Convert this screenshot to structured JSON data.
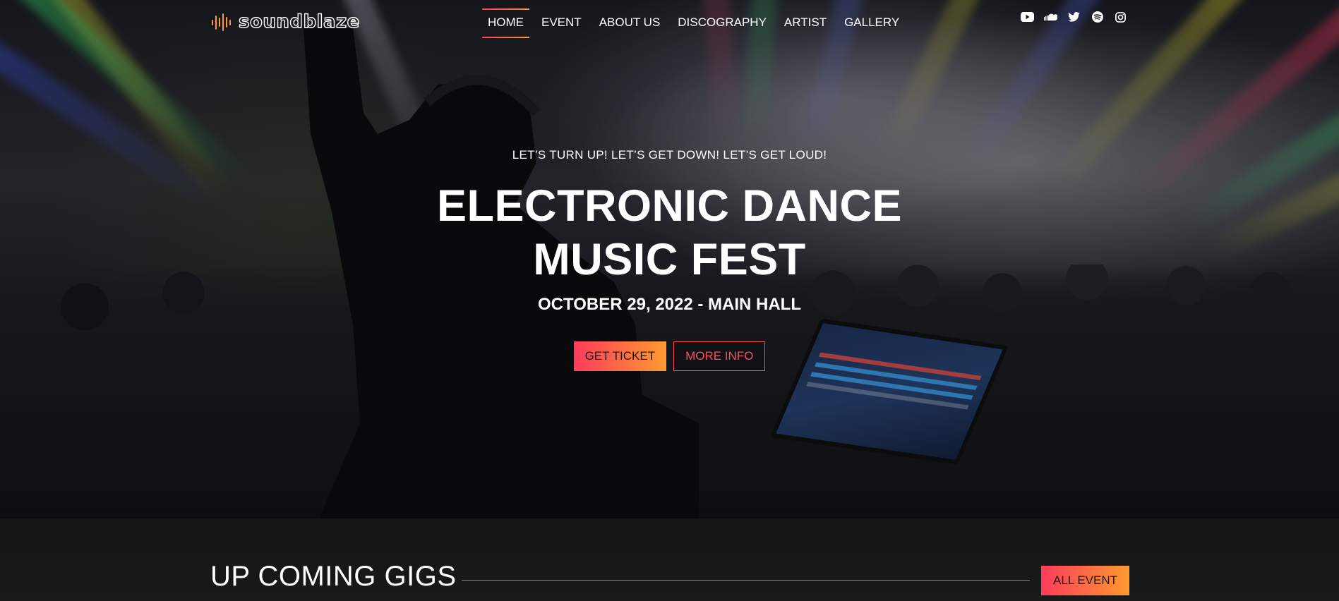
{
  "brand": {
    "name": "soundblaze"
  },
  "nav": {
    "items": [
      {
        "label": "HOME",
        "active": true
      },
      {
        "label": "EVENT",
        "active": false
      },
      {
        "label": "ABOUT US",
        "active": false
      },
      {
        "label": "DISCOGRAPHY",
        "active": false
      },
      {
        "label": "ARTIST",
        "active": false
      },
      {
        "label": "GALLERY",
        "active": false
      }
    ]
  },
  "social": [
    "youtube-icon",
    "soundcloud-icon",
    "twitter-icon",
    "spotify-icon",
    "instagram-icon"
  ],
  "hero": {
    "tagline": "LET’S TURN UP! LET’S GET DOWN! LET’S GET LOUD!",
    "title": "ELECTRONIC DANCE MUSIC FEST",
    "date": "OCTOBER 29, 2022 - MAIN HALL",
    "primary_button": "GET TICKET",
    "secondary_button": "MORE INFO"
  },
  "gigs": {
    "title": "UP COMING GIGS",
    "button": "ALL EVENT"
  },
  "colors": {
    "accent_start": "#ff3b5c",
    "accent_end": "#ff9a2e",
    "outline": "#ff4d5e",
    "background": "#141414"
  }
}
